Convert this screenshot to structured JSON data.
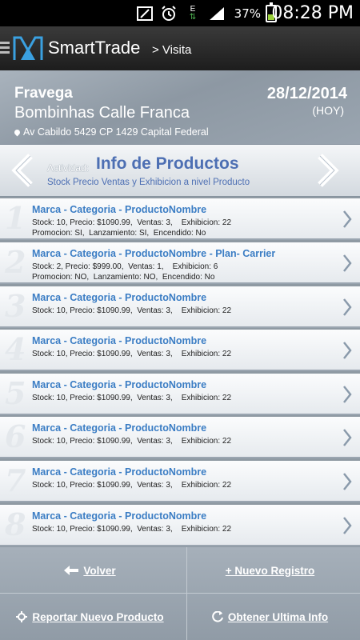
{
  "statusbar": {
    "time": "08:28 PM",
    "battery": "37%",
    "network_letter": "E"
  },
  "appbar": {
    "app_name": "SmartTrade",
    "breadcrumb": "> Visita"
  },
  "header": {
    "store": "Fravega",
    "branch": "Bombinhas Calle Franca",
    "address": "Av Cabildo 5429 CP 1429 Capital Federal",
    "date": "28/12/2014",
    "today": "(HOY)"
  },
  "activity": {
    "label": "Actividad:",
    "title": "Info de Productos",
    "description": "Stock Precio Ventas y Exhibicion a nivel Producto"
  },
  "products": [
    {
      "num": "1",
      "title": "Marca - Categoria - ProductoNombre",
      "line1": "Stock: 10, Precio: $1090.99,  Ventas: 3,    Exhibicion: 22",
      "line2": "Promocion: SI,  Lanzamiento: SI,  Encendido: No"
    },
    {
      "num": "2",
      "title": "Marca - Categoria - ProductoNombre - Plan- Carrier",
      "line1": "Stock: 2, Precio: $999.00,  Ventas: 1,    Exhibicion: 6",
      "line2": "Promocion: NO,  Lanzamiento: NO,  Encendido: No"
    },
    {
      "num": "3",
      "title": "Marca - Categoria - ProductoNombre",
      "line1": "Stock: 10, Precio: $1090.99,  Ventas: 3,    Exhibicion: 22",
      "line2": ""
    },
    {
      "num": "4",
      "title": "Marca - Categoria - ProductoNombre",
      "line1": "Stock: 10, Precio: $1090.99,  Ventas: 3,    Exhibicion: 22",
      "line2": ""
    },
    {
      "num": "5",
      "title": "Marca - Categoria - ProductoNombre",
      "line1": "Stock: 10, Precio: $1090.99,  Ventas: 3,    Exhibicion: 22",
      "line2": ""
    },
    {
      "num": "6",
      "title": "Marca - Categoria - ProductoNombre",
      "line1": "Stock: 10, Precio: $1090.99,  Ventas: 3,    Exhibicion: 22",
      "line2": ""
    },
    {
      "num": "7",
      "title": "Marca - Categoria - ProductoNombre",
      "line1": "Stock: 10, Precio: $1090.99,  Ventas: 3,    Exhibicion: 22",
      "line2": ""
    },
    {
      "num": "8",
      "title": "Marca - Categoria - ProductoNombre",
      "line1": "Stock: 10, Precio: $1090.99,  Ventas: 3,    Exhibicion: 22",
      "line2": ""
    }
  ],
  "footer": {
    "back": "Volver",
    "new_record": "+ Nuevo Registro",
    "report_product": "Reportar Nuevo Producto",
    "get_last_info": "Obtener Ultima Info"
  },
  "colors": {
    "accent": "#4d6fb3",
    "link": "#3b7dc4",
    "battery": "#9ad13a"
  }
}
